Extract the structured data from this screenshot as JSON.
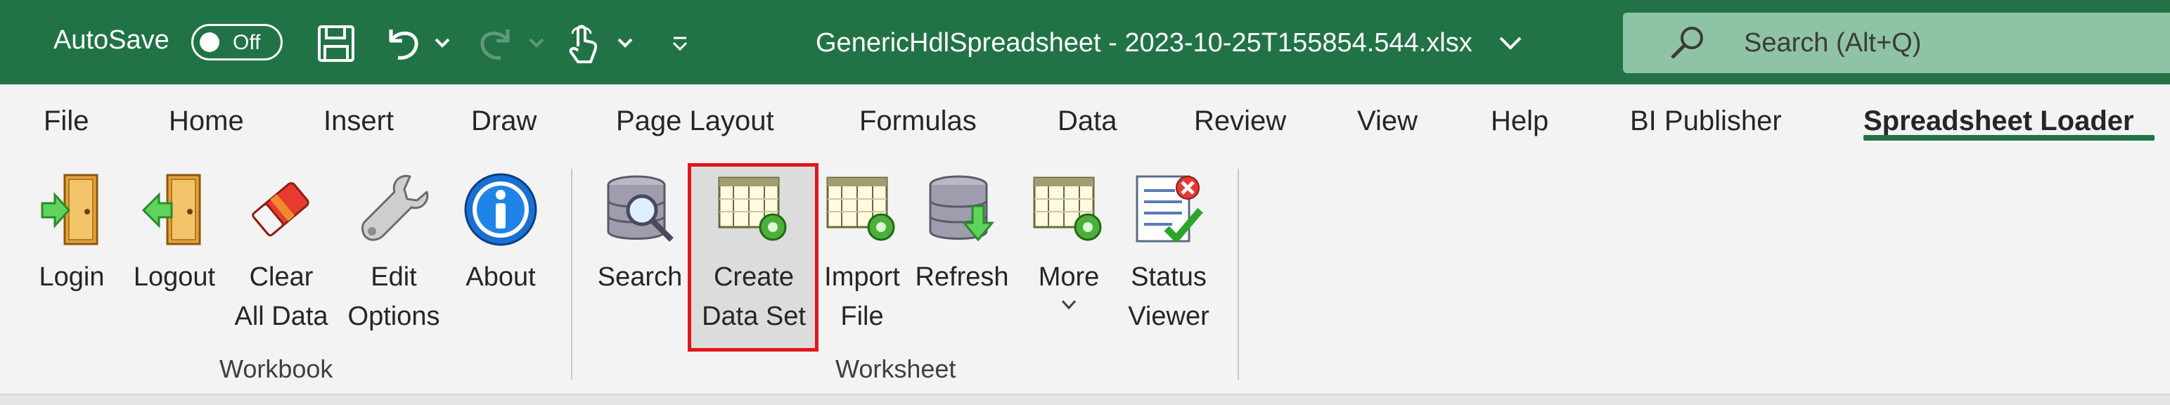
{
  "titlebar": {
    "autosave_label": "AutoSave",
    "autosave_state": "Off",
    "document_title": "GenericHdlSpreadsheet - 2023-10-25T155854.544.xlsx",
    "search_placeholder": "Search (Alt+Q)"
  },
  "tabs": [
    {
      "label": "File"
    },
    {
      "label": "Home"
    },
    {
      "label": "Insert"
    },
    {
      "label": "Draw"
    },
    {
      "label": "Page Layout"
    },
    {
      "label": "Formulas"
    },
    {
      "label": "Data"
    },
    {
      "label": "Review"
    },
    {
      "label": "View"
    },
    {
      "label": "Help"
    },
    {
      "label": "BI Publisher"
    },
    {
      "label": "Spreadsheet Loader",
      "active": true
    }
  ],
  "ribbon": {
    "workbook": {
      "group_label": "Workbook",
      "buttons": [
        {
          "line1": "Login",
          "line2": "",
          "icon": "login-door-icon"
        },
        {
          "line1": "Logout",
          "line2": "",
          "icon": "logout-door-icon"
        },
        {
          "line1": "Clear",
          "line2": "All Data",
          "icon": "eraser-icon"
        },
        {
          "line1": "Edit",
          "line2": "Options",
          "icon": "wrench-icon"
        },
        {
          "line1": "About",
          "line2": "",
          "icon": "info-icon"
        }
      ]
    },
    "worksheet": {
      "group_label": "Worksheet",
      "buttons": [
        {
          "line1": "Search",
          "line2": "",
          "icon": "database-search-icon"
        },
        {
          "line1": "Create",
          "line2": "Data Set",
          "icon": "create-dataset-icon"
        },
        {
          "line1": "Import",
          "line2": "File",
          "icon": "import-file-icon"
        },
        {
          "line1": "Refresh",
          "line2": "",
          "icon": "database-refresh-icon"
        },
        {
          "line1": "More",
          "line2": "",
          "icon": "more-options-icon"
        },
        {
          "line1": "Status",
          "line2": "Viewer",
          "icon": "status-viewer-icon"
        }
      ]
    }
  },
  "colors": {
    "title_bar": "#217346",
    "search_box": "#8fc3a5",
    "highlight_border": "#e0161c",
    "active_tab_underline": "#217346"
  }
}
